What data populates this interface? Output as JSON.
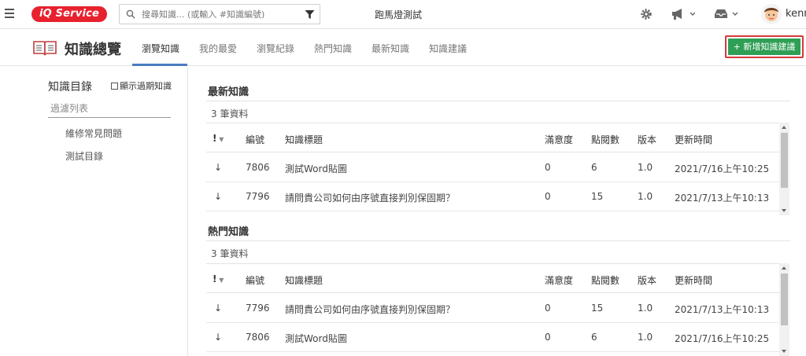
{
  "topbar": {
    "logo": "iQ Service",
    "search_placeholder": "搜尋知識... (或輸入 #知識編號)",
    "marquee": "跑馬燈測試",
    "username": "kenn"
  },
  "header": {
    "title": "知識總覽",
    "tabs": [
      "瀏覽知識",
      "我的最愛",
      "瀏覽紀錄",
      "熱門知識",
      "最新知識",
      "知識建議"
    ],
    "add_button": "新增知識建議"
  },
  "sidebar": {
    "title": "知識目錄",
    "show_expired_label": "顯示過期知識",
    "filter_placeholder": "過濾列表",
    "items": [
      "維修常見問題",
      "測試目錄"
    ]
  },
  "columns": [
    "!",
    "編號",
    "知識標題",
    "滿意度",
    "點閱數",
    "版本",
    "更新時間"
  ],
  "sections": [
    {
      "title": "最新知識",
      "count": "3 筆資料",
      "rows": [
        {
          "priority": "↓",
          "id": "7806",
          "title": "測試Word貼圖",
          "satisfaction": "0",
          "views": "6",
          "version": "1.0",
          "updated": "2021/7/16上午10:25"
        },
        {
          "priority": "↓",
          "id": "7796",
          "title": "請問貴公司如何由序號直接判別保固期？",
          "satisfaction": "0",
          "views": "15",
          "version": "1.0",
          "updated": "2021/7/13上午10:13"
        }
      ]
    },
    {
      "title": "熱門知識",
      "count": "3 筆資料",
      "rows": [
        {
          "priority": "↓",
          "id": "7796",
          "title": "請問貴公司如何由序號直接判別保固期？",
          "satisfaction": "0",
          "views": "15",
          "version": "1.0",
          "updated": "2021/7/13上午10:13"
        },
        {
          "priority": "↓",
          "id": "7806",
          "title": "測試Word貼圖",
          "satisfaction": "0",
          "views": "6",
          "version": "1.0",
          "updated": "2021/7/16上午10:25"
        }
      ]
    }
  ],
  "colors": {
    "brand_red": "#e8212e",
    "add_green": "#2e9f55",
    "highlight_red": "#d43a3a",
    "tab_accent": "#4a7bbf"
  }
}
